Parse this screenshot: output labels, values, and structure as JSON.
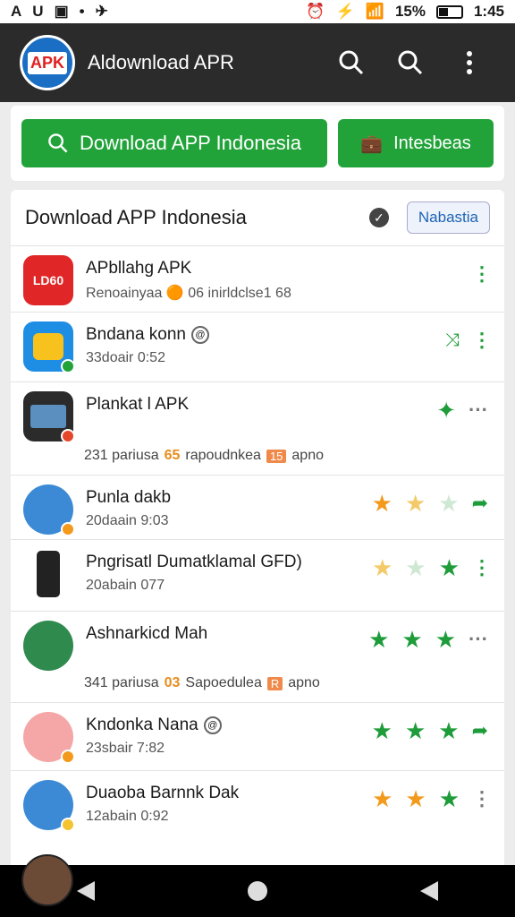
{
  "status": {
    "percent": "15%",
    "time": "1:45"
  },
  "header": {
    "title": "Aldownload APR",
    "logo_text": "APK"
  },
  "top": {
    "download_label": "Download APP Indonesia",
    "secondary_label": "Intesbeas"
  },
  "list": {
    "title": "Download APP Indonesia",
    "action_label": "Nabastia",
    "items": [
      {
        "name": "APbllahg APK",
        "sub": "Renoainyaa 🟠 06 inirldclse1 68",
        "icon": "LD60"
      },
      {
        "name": "Bndana konn",
        "sub": "33doair 0:52"
      },
      {
        "name": "Plankat l APK",
        "meta_a": "231 pariusa",
        "meta_b": "65",
        "meta_c": "rapoudnkea",
        "meta_d": "15",
        "meta_e": "apno"
      },
      {
        "name": "Punla dakb",
        "sub": "20daain 9:03"
      },
      {
        "name": "Pngrisatl Dumatklamal GFD)",
        "sub": "20abain 077"
      },
      {
        "name": "Ashnarkicd Mah",
        "meta_a": "341 pariusa",
        "meta_b": "03",
        "meta_c": "Sapoedulea",
        "meta_d": "R",
        "meta_e": "apno"
      },
      {
        "name": "Kndonka Nana",
        "sub": "23sbair 7:82"
      },
      {
        "name": "Duaoba Barnnk Dak",
        "sub": "12abain 0:92"
      }
    ]
  },
  "colors": {
    "accent": "#22a33a",
    "appbar": "#2b2b2b",
    "star_orange": "#f39a1d"
  }
}
